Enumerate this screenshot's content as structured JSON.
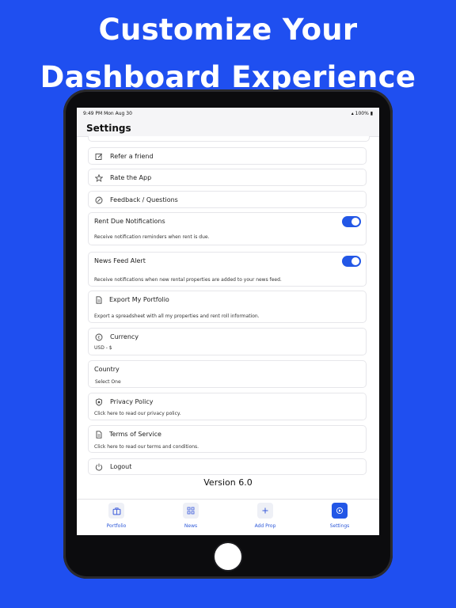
{
  "headline": {
    "line1": "Customize Your",
    "line2": "Dashboard Experience"
  },
  "status_bar": {
    "time": "9:49 PM  Mon Aug 30",
    "battery": "▴ 100% ▮"
  },
  "nav": {
    "title": "Settings"
  },
  "settings": {
    "refer": {
      "label": "Refer a friend",
      "icon": "edit-icon"
    },
    "rate": {
      "label": "Rate the App",
      "icon": "star-icon"
    },
    "feedback": {
      "label": "Feedback / Questions",
      "icon": "compass-icon"
    },
    "rent_due": {
      "label": "Rent Due Notifications",
      "description": "Receive notification reminders when rent is due.",
      "enabled": true
    },
    "news_feed": {
      "label": "News Feed Alert",
      "description": "Receive notifications when new rental properties are added to your news feed.",
      "enabled": true
    },
    "export": {
      "label": "Export My Portfolio",
      "description": "Export a spreadsheet with all my properties and rent roll information.",
      "icon": "document-icon"
    },
    "currency": {
      "label": "Currency",
      "value": "USD - $",
      "icon": "euro-circle-icon"
    },
    "country": {
      "label": "Country",
      "value": "Select One"
    },
    "privacy": {
      "label": "Privacy Policy",
      "description": "Click here to read our privacy policy.",
      "icon": "shield-icon"
    },
    "terms": {
      "label": "Terms of Service",
      "description": "Click here to read our terms and conditions.",
      "icon": "document-icon"
    },
    "logout": {
      "label": "Logout",
      "icon": "power-icon"
    }
  },
  "version": "Version 6.0",
  "tabs": [
    {
      "label": "Portfolio",
      "icon": "briefcase-icon"
    },
    {
      "label": "News",
      "icon": "grid-icon"
    },
    {
      "label": "Add Prop",
      "icon": "plus-icon"
    },
    {
      "label": "Settings",
      "icon": "gear-icon",
      "active": true
    }
  ],
  "colors": {
    "background": "#1f4ff0",
    "accent": "#2357e6",
    "tablet": "#0c0c0e"
  }
}
